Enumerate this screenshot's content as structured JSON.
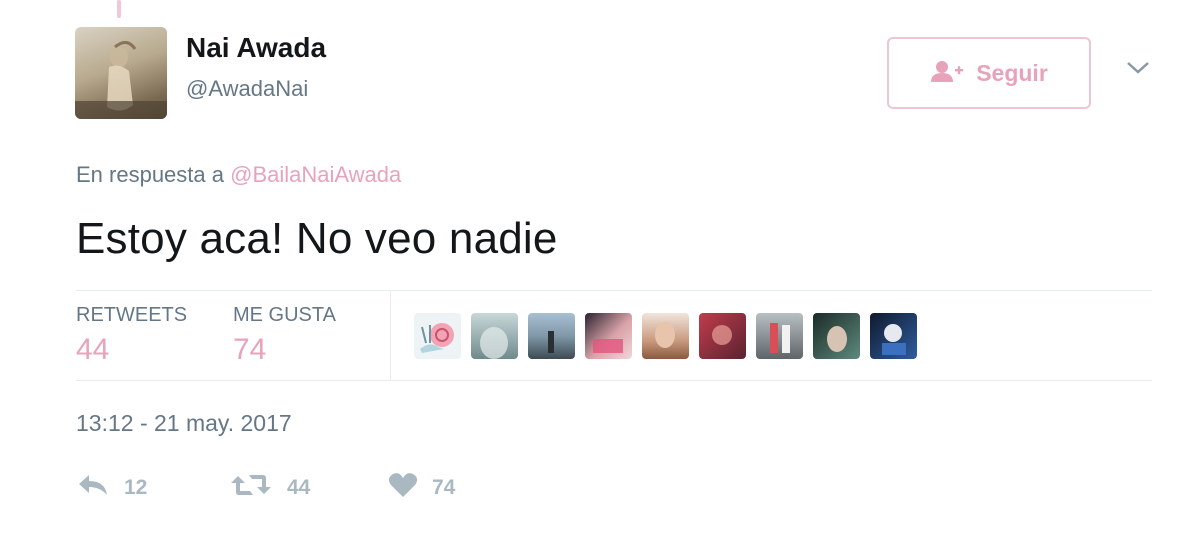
{
  "author": {
    "name": "Nai Awada",
    "handle": "@AwadaNai"
  },
  "follow_button": {
    "label": "Seguir",
    "icon": "add-user-icon"
  },
  "menu": {
    "icon": "chevron-down-icon"
  },
  "reply_context": {
    "prefix": "En respuesta a",
    "mention": "@BailaNaiAwada"
  },
  "tweet": {
    "text": "Estoy aca! No veo nadie"
  },
  "stats": {
    "retweets_label": "RETWEETS",
    "retweets_value": "44",
    "likes_label": "ME GUSTA",
    "likes_value": "74"
  },
  "likers_count_shown": 9,
  "timestamp": "13:12 - 21 may. 2017",
  "actions": {
    "reply": {
      "icon": "reply-icon",
      "count": "12"
    },
    "retweet": {
      "icon": "retweet-icon",
      "count": "44"
    },
    "like": {
      "icon": "heart-icon",
      "count": "74"
    }
  },
  "colors": {
    "accent": "#e8a3ba",
    "accent_border": "#f0c5d3",
    "secondary_text": "#657786",
    "action_gray": "#aab8c2"
  }
}
